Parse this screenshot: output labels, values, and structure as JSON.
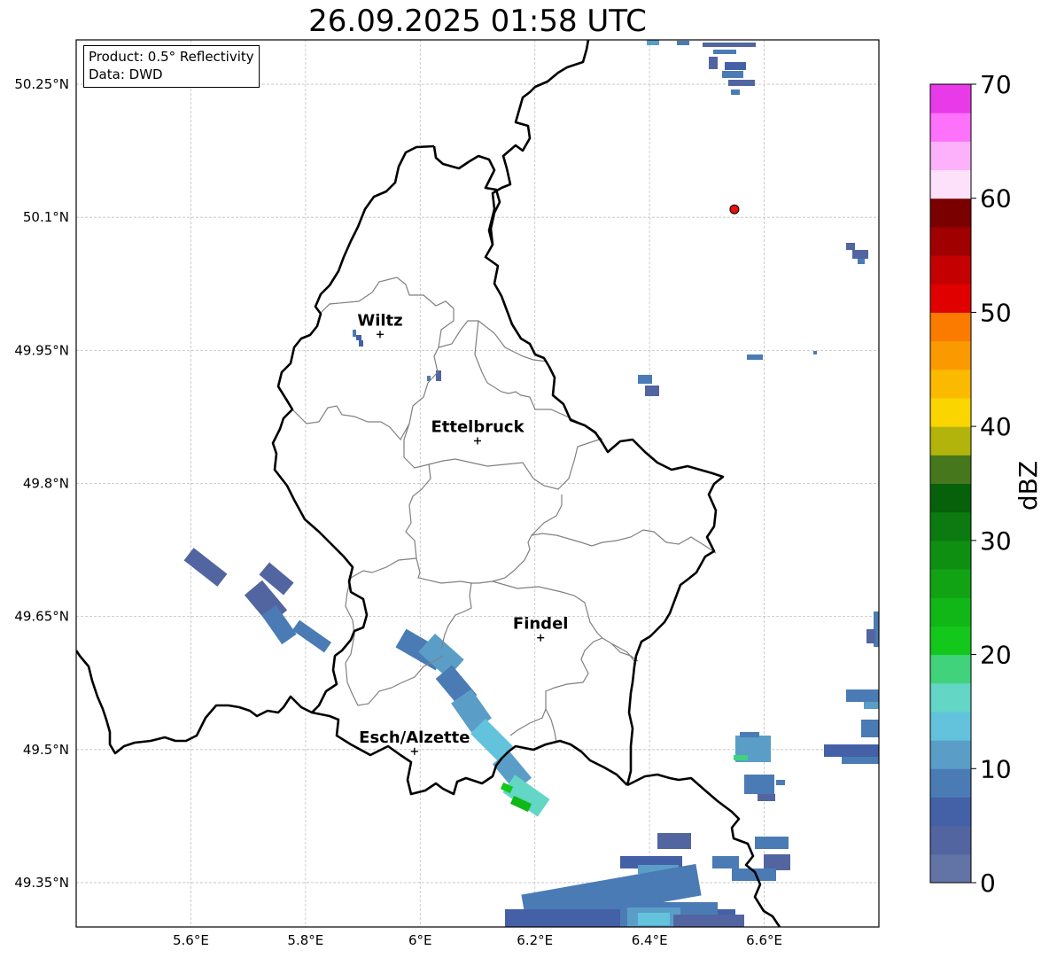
{
  "title": "26.09.2025 01:58 UTC",
  "info": {
    "product": "Product: 0.5° Reflectivity",
    "source": "Data: DWD"
  },
  "axes": {
    "x_ticks": [
      "5.6°E",
      "5.8°E",
      "6°E",
      "6.2°E",
      "6.4°E",
      "6.6°E"
    ],
    "y_ticks": [
      "50.25°N",
      "50.1°N",
      "49.95°N",
      "49.8°N",
      "49.65°N",
      "49.5°N",
      "49.35°N"
    ],
    "lon_range": [
      5.4,
      6.8
    ],
    "lat_range": [
      49.3,
      50.3
    ],
    "grid": true
  },
  "cities": [
    {
      "name": "Wiltz",
      "lon": 5.93,
      "lat": 49.968
    },
    {
      "name": "Ettelbruck",
      "lon": 6.1,
      "lat": 49.848
    },
    {
      "name": "Findel",
      "lon": 6.21,
      "lat": 49.626
    },
    {
      "name": "Esch/Alzette",
      "lon": 5.99,
      "lat": 49.498
    }
  ],
  "radar_site": {
    "lon": 6.548,
    "lat": 50.109,
    "color": "#e81010"
  },
  "colorbar": {
    "label": "dBZ",
    "min": 0,
    "max": 70,
    "tick_labels": [
      "0",
      "10",
      "20",
      "30",
      "40",
      "50",
      "60",
      "70"
    ],
    "colors": [
      "#6273a5",
      "#5265a0",
      "#4460a6",
      "#4a7bb5",
      "#5a9ec8",
      "#64c3dc",
      "#63d6c6",
      "#40d37c",
      "#13c71b",
      "#11b716",
      "#11a314",
      "#0f8f12",
      "#0b7a10",
      "#07600a",
      "#46771c",
      "#b2b40c",
      "#fbd500",
      "#fbb900",
      "#fb9a00",
      "#fb7b00",
      "#e00000",
      "#c40000",
      "#a00000",
      "#7a0000",
      "#fde1fb",
      "#fdb1fb",
      "#fd71fb",
      "#e83ae8"
    ]
  }
}
